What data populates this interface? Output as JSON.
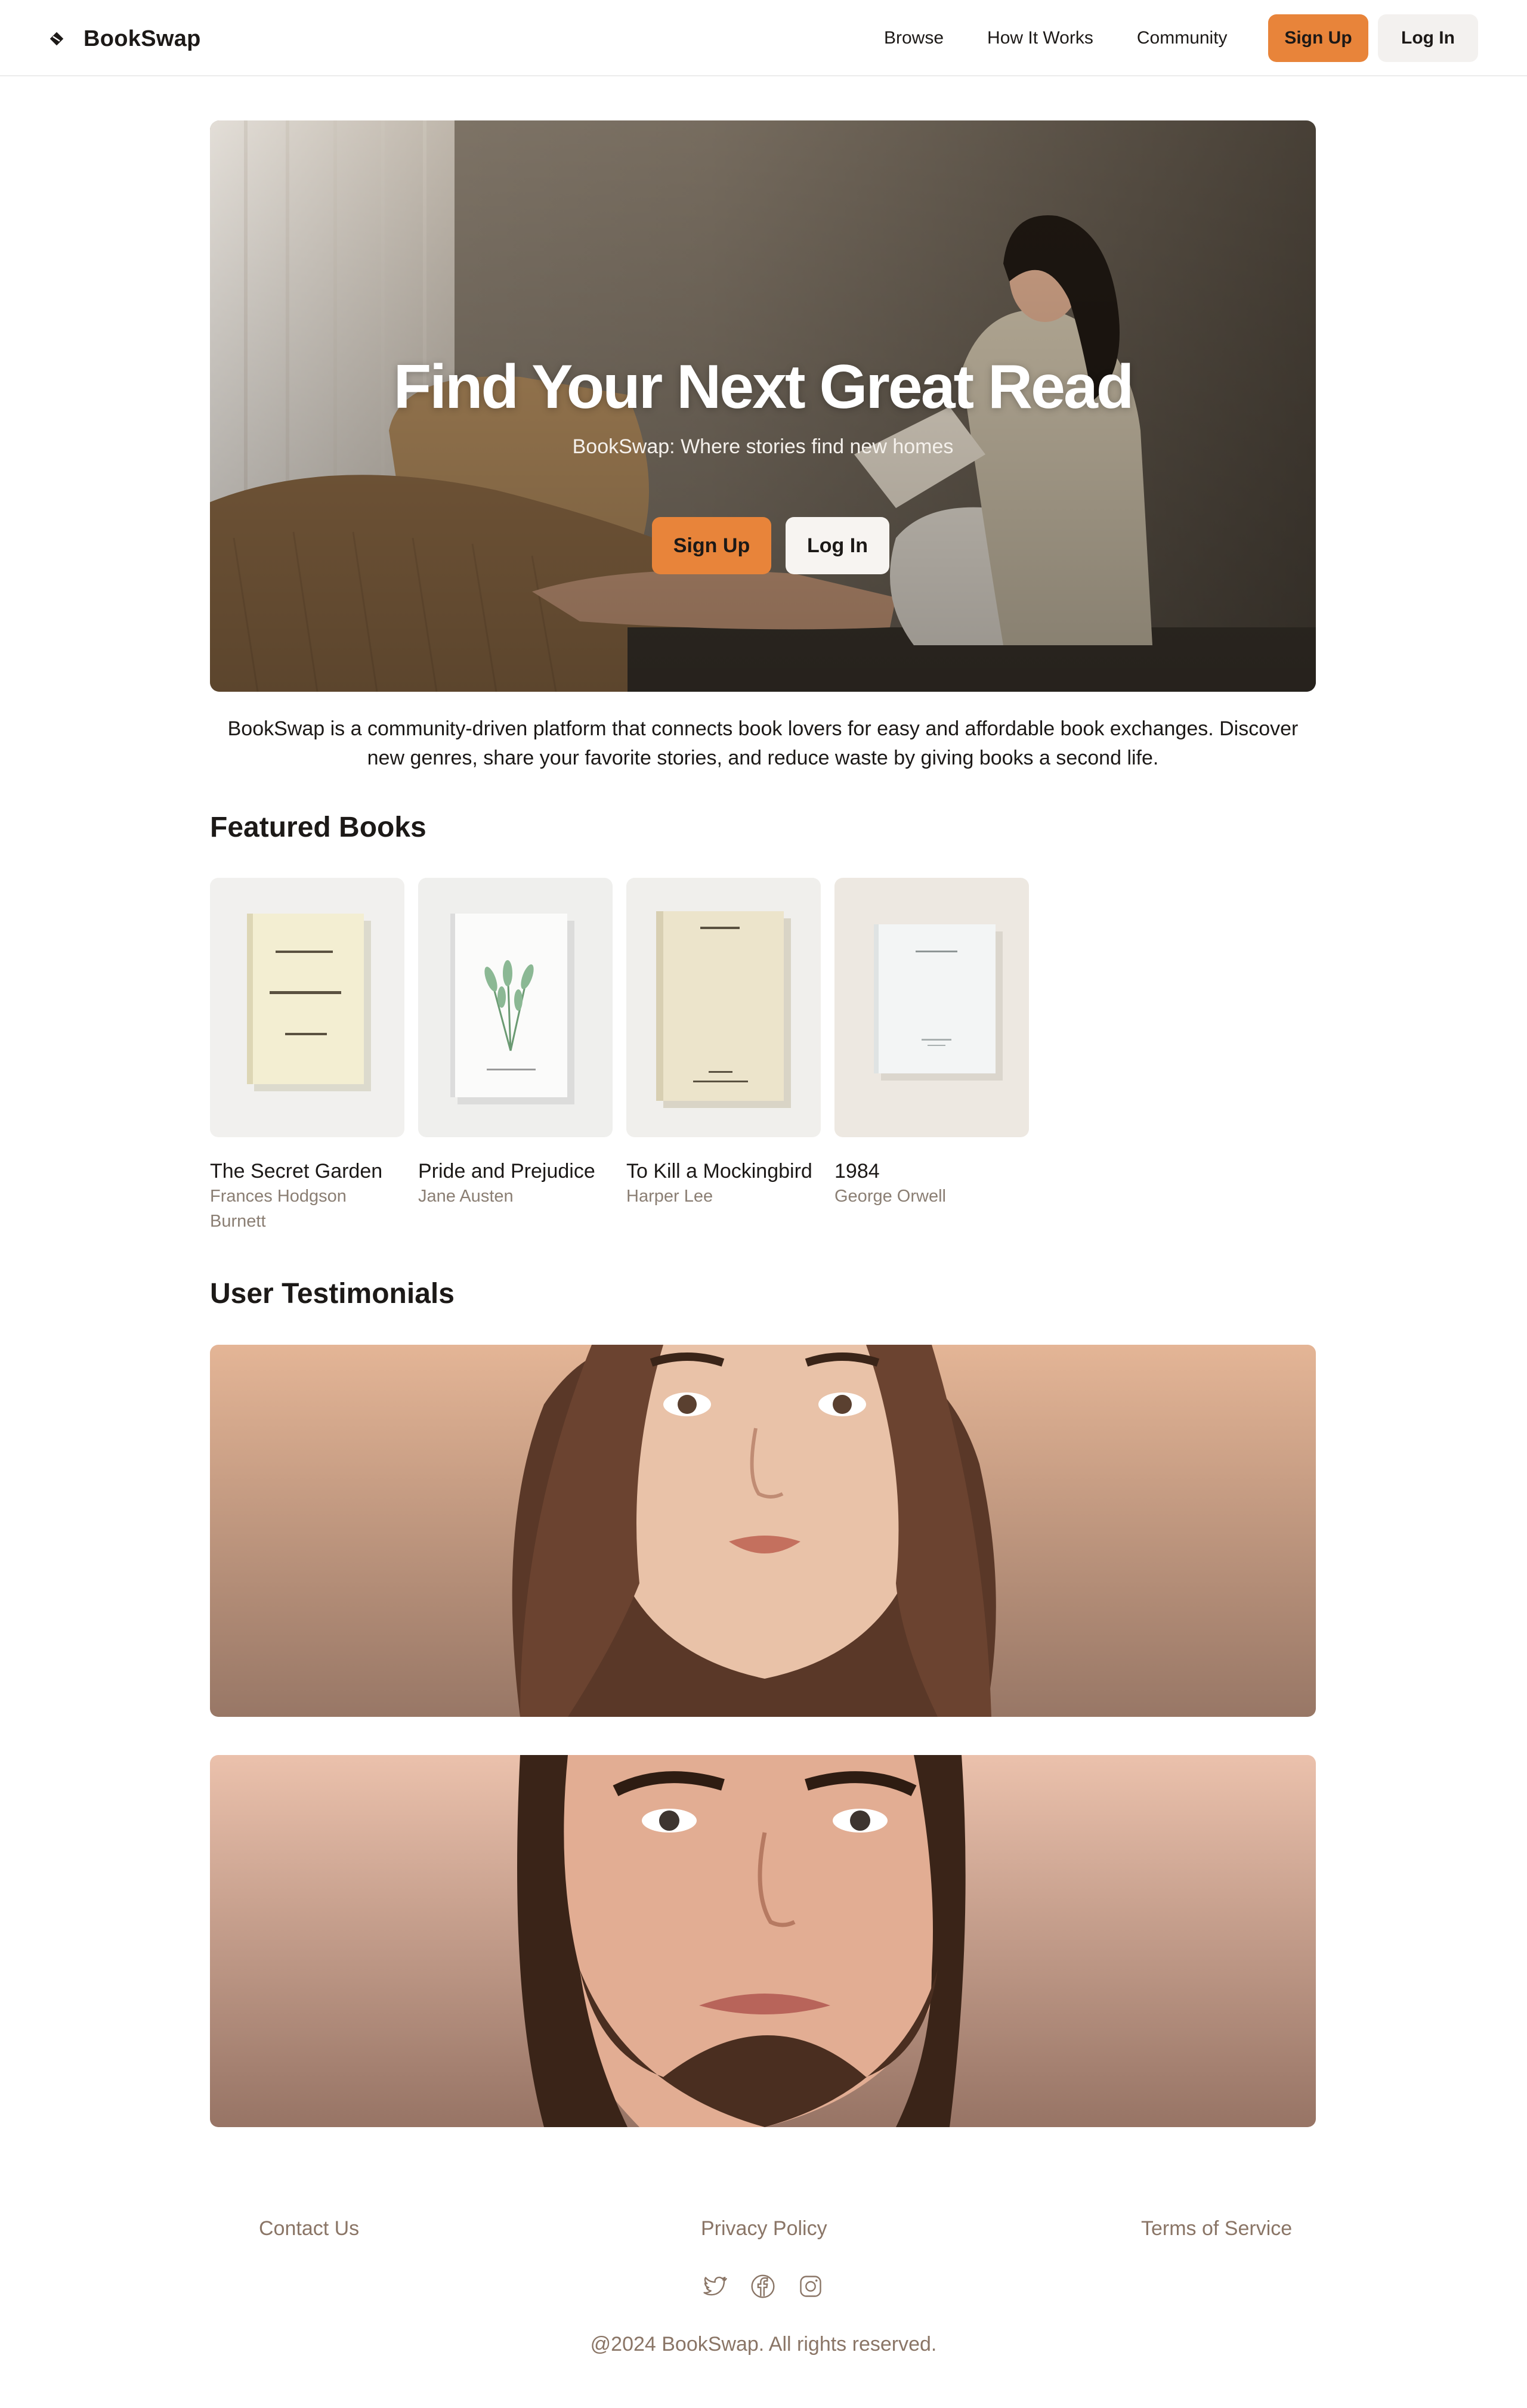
{
  "header": {
    "brand": "BookSwap",
    "brand_icon": "book-leaf-icon",
    "nav": [
      "Browse",
      "How It Works",
      "Community"
    ],
    "signup_label": "Sign Up",
    "login_label": "Log In"
  },
  "hero": {
    "title": "Find Your Next Great Read",
    "subtitle": "BookSwap: Where stories find new homes",
    "signup_label": "Sign Up",
    "login_label": "Log In"
  },
  "intro": "BookSwap is a community-driven platform that connects book lovers for easy and affordable book exchanges. Discover new genres, share your favorite stories, and reduce waste by giving books a second life.",
  "featured": {
    "title": "Featured Books",
    "books": [
      {
        "title": "The Secret Garden",
        "author": "Frances Hodgson Burnett"
      },
      {
        "title": "Pride and Prejudice",
        "author": "Jane Austen"
      },
      {
        "title": "To Kill a Mockingbird",
        "author": "Harper Lee"
      },
      {
        "title": "1984",
        "author": "George Orwell"
      }
    ]
  },
  "testimonials": {
    "title": "User Testimonials"
  },
  "footer": {
    "links": [
      "Contact Us",
      "Privacy Policy",
      "Terms of Service"
    ],
    "social_icons": [
      "twitter-icon",
      "facebook-icon",
      "instagram-icon"
    ],
    "copyright": "@2024 BookSwap. All rights reserved."
  },
  "colors": {
    "accent": "#e8843a",
    "muted_text": "#8a7566"
  }
}
